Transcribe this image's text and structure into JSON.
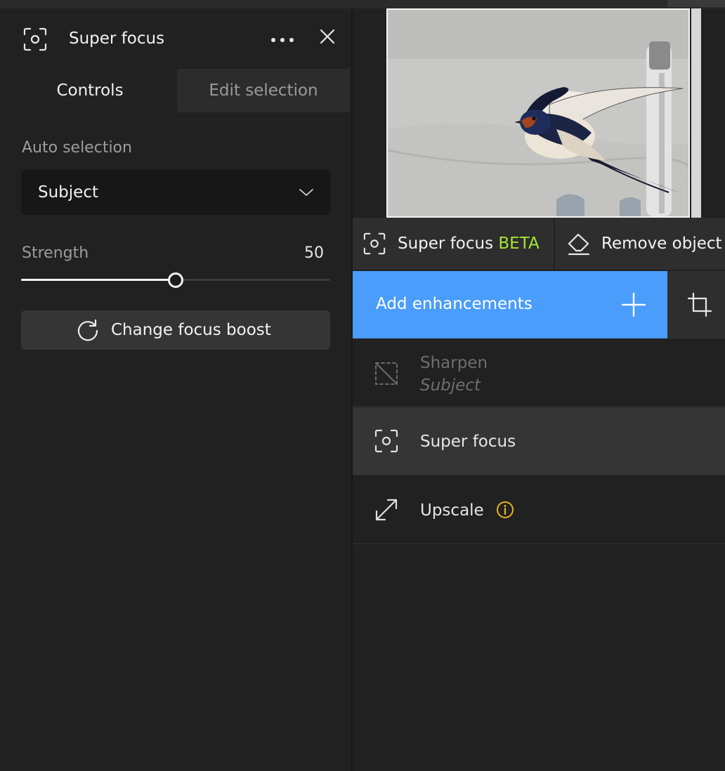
{
  "panel": {
    "title": "Super focus",
    "tabs": [
      {
        "label": "Controls",
        "active": true
      },
      {
        "label": "Edit selection",
        "active": false
      }
    ],
    "auto_selection": {
      "label": "Auto selection",
      "selected": "Subject"
    },
    "strength": {
      "label": "Strength",
      "value": "50",
      "fraction": 0.5
    },
    "boost_button": {
      "label": "Change focus boost"
    }
  },
  "toolbar": {
    "super_focus": {
      "label": "Super focus",
      "badge": "BETA",
      "badge_color": "#a3e635"
    },
    "remove_object": {
      "label": "Remove object"
    }
  },
  "enhancements": {
    "add_label": "Add enhancements",
    "accent": "#4a9dfb",
    "items": [
      {
        "name": "Sharpen",
        "sub": "Subject",
        "icon": "sharpen-disabled-icon",
        "state": "disabled"
      },
      {
        "name": "Super focus",
        "icon": "super-focus-icon",
        "state": "selected"
      },
      {
        "name": "Upscale",
        "icon": "upscale-icon",
        "info": true,
        "info_color": "#e6b31e"
      }
    ]
  }
}
